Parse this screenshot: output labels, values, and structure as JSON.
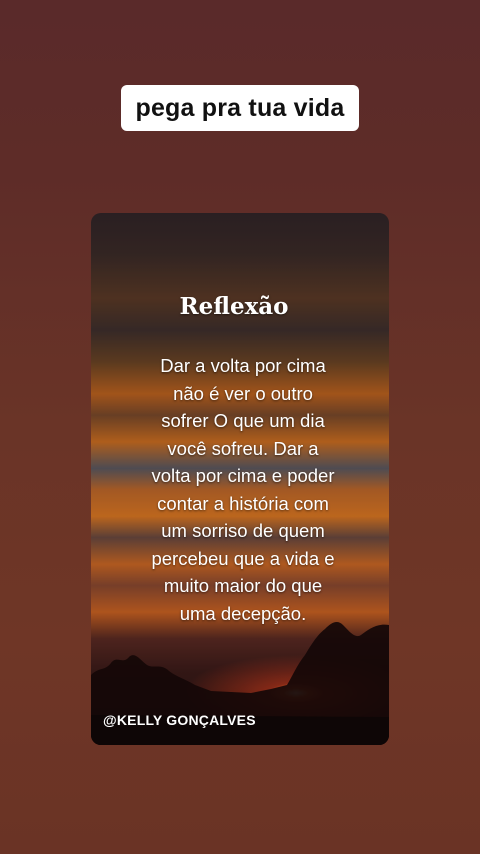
{
  "story": {
    "caption": "pega pra tua vida"
  },
  "post": {
    "title": "Reflexão",
    "body": "Dar a volta por cima não é ver o outro sofrer O que um dia você sofreu. Dar a volta por cima e poder contar a história com um sorriso de quem percebeu que a vida e muito maior do que uma decepção.",
    "credit": "@KELLY GONÇALVES"
  },
  "colors": {
    "background": "#5e2c28",
    "caption_bg": "#ffffff",
    "caption_text": "#111111",
    "sunset_orange": "#e07a22",
    "text_white": "#ffffff"
  }
}
